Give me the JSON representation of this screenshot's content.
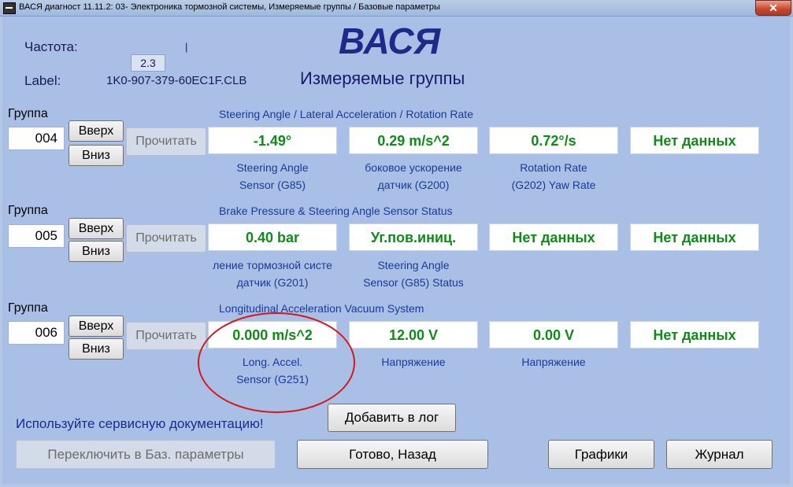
{
  "window": {
    "title": "ВАСЯ диагност 11.11.2: 03- Электроника тормозной системы,  Измеряемые группы / Базовые параметры",
    "close_icon": "close-icon",
    "close_glyph": "✕"
  },
  "header": {
    "frequency_label": "Частота:",
    "frequency_value": "2.3",
    "frequency_marker": "|",
    "label_label": "Label:",
    "label_value": "1K0-907-379-60EC1F.CLB",
    "brand": "ВАСЯ",
    "subtitle": "Измеряемые группы"
  },
  "groups": [
    {
      "label": "Группа",
      "number": "004",
      "up_label": "Вверх",
      "down_label": "Вниз",
      "read_label": "Прочитать",
      "header": "Steering Angle / Lateral Acceleration / Rotation Rate",
      "values": [
        "-1.49°",
        "0.29 m/s^2",
        "0.72°/s",
        "Нет данных"
      ],
      "descriptions": [
        "Steering Angle\nSensor (G85)",
        "боковое ускорение\nдатчик (G200)",
        "Rotation Rate\n(G202) Yaw Rate",
        ""
      ]
    },
    {
      "label": "Группа",
      "number": "005",
      "up_label": "Вверх",
      "down_label": "Вниз",
      "read_label": "Прочитать",
      "header": "Brake Pressure & Steering Angle Sensor Status",
      "values": [
        "0.40 bar",
        "Уг.пов.иниц.",
        "Нет данных",
        "Нет данных"
      ],
      "descriptions": [
        "ление тормозной систе\nдатчик (G201)",
        "Steering Angle\nSensor (G85) Status",
        "",
        ""
      ]
    },
    {
      "label": "Группа",
      "number": "006",
      "up_label": "Вверх",
      "down_label": "Вниз",
      "read_label": "Прочитать",
      "header": "Longitudinal Acceleration  Vacuum System",
      "values": [
        "0.000 m/s^2",
        "12.00 V",
        "0.00 V",
        "Нет данных"
      ],
      "descriptions": [
        "Long. Accel.\nSensor (G251)",
        "Напряжение",
        "Напряжение",
        ""
      ]
    }
  ],
  "footer": {
    "hint": "Используйте сервисную документацию!",
    "add_log_label": "Добавить в лог",
    "switch_basic_label": "Переключить в Баз. параметры",
    "done_back_label": "Готово, Назад",
    "graphs_label": "Графики",
    "journal_label": "Журнал"
  },
  "colors": {
    "background": "#a9bfe6",
    "value_text": "#0f8b1a",
    "annotation_circle": "#d61818"
  }
}
